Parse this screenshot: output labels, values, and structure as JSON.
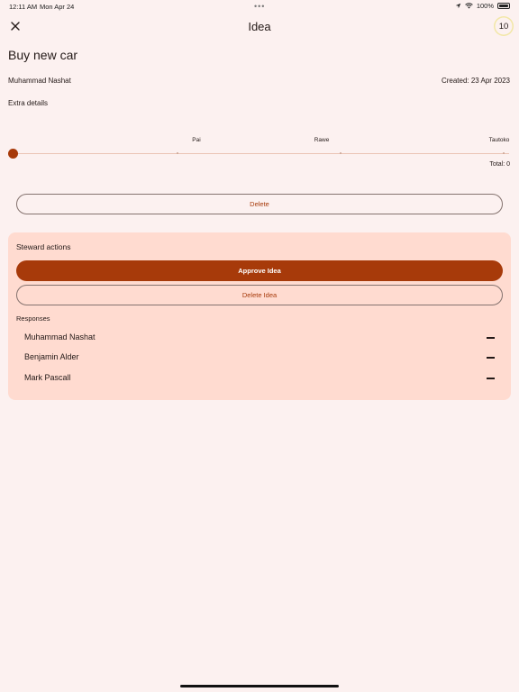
{
  "status_bar": {
    "time": "12:11 AM",
    "date": "Mon Apr 24",
    "dots": "•••",
    "battery_percent": "100%"
  },
  "app_bar": {
    "title": "Idea",
    "count": "10",
    "close_icon": "close-icon"
  },
  "idea": {
    "title": "Buy new car",
    "author": "Muhammad Nashat",
    "created": "Created: 23 Apr 2023",
    "extra_details": "Extra details"
  },
  "slider": {
    "labels": [
      "Pai",
      "Rawe",
      "Tautoko"
    ],
    "value": 0,
    "max": 3,
    "total_label": "Total: 0"
  },
  "actions": {
    "delete_label": "Delete"
  },
  "steward": {
    "title": "Steward actions",
    "approve_label": "Approve Idea",
    "delete_idea_label": "Delete Idea",
    "responses_title": "Responses",
    "responses": [
      {
        "name": "Muhammad Nashat",
        "status_icon": "dash-icon"
      },
      {
        "name": "Benjamin Alder",
        "status_icon": "dash-icon"
      },
      {
        "name": "Mark Pascall",
        "status_icon": "dash-icon"
      }
    ]
  },
  "colors": {
    "primary": "#a73a0a",
    "background": "#fcf1f0",
    "card": "#ffdbd0",
    "outline": "#85736f"
  }
}
